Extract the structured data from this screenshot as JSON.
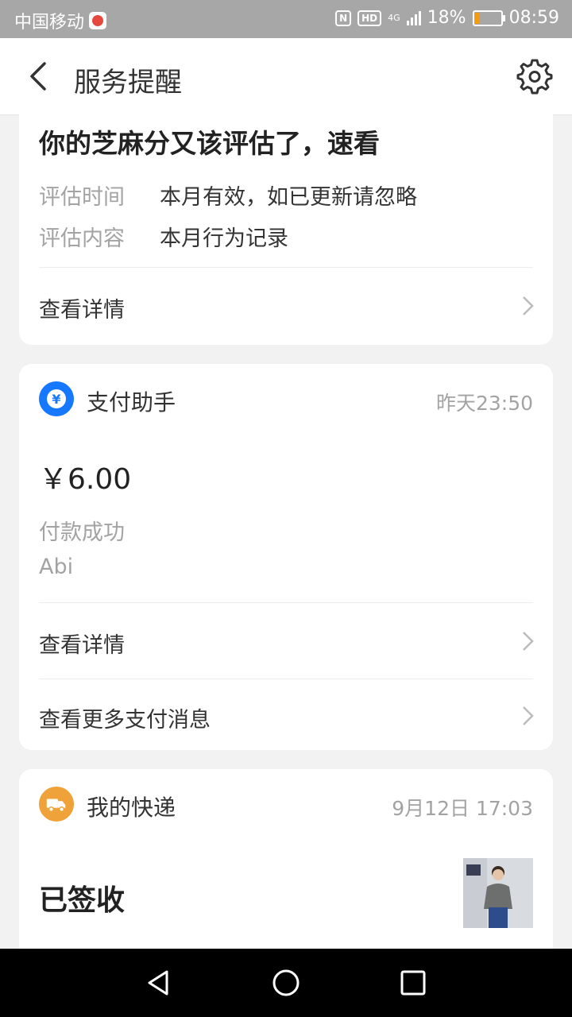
{
  "status_bar": {
    "carrier": "中国移动",
    "nfc": "N",
    "hd": "HD",
    "network": "4G",
    "battery_pct": "18%",
    "battery_level": 0.18,
    "time": "08:59"
  },
  "header": {
    "title": "服务提醒"
  },
  "card_zhima": {
    "title": "你的芝麻分又该评估了，速看",
    "rows": [
      {
        "label": "评估时间",
        "value": "本月有效，如已更新请忽略"
      },
      {
        "label": "评估内容",
        "value": "本月行为记录"
      }
    ],
    "link": "查看详情"
  },
  "card_payment": {
    "name": "支付助手",
    "time": "昨天23:50",
    "icon": "yen-icon",
    "amount": "￥6.00",
    "status": "付款成功",
    "merchant": "Abi",
    "links": [
      "查看详情",
      "查看更多支付消息"
    ],
    "accent": "#1677ff"
  },
  "card_express": {
    "name": "我的快递",
    "time": "9月12日 17:03",
    "icon": "truck-icon",
    "status": "已签收",
    "accent": "#f0a23a"
  },
  "sysnav": {
    "back": "back-triangle-icon",
    "home": "home-circle-icon",
    "recent": "recent-square-icon"
  }
}
